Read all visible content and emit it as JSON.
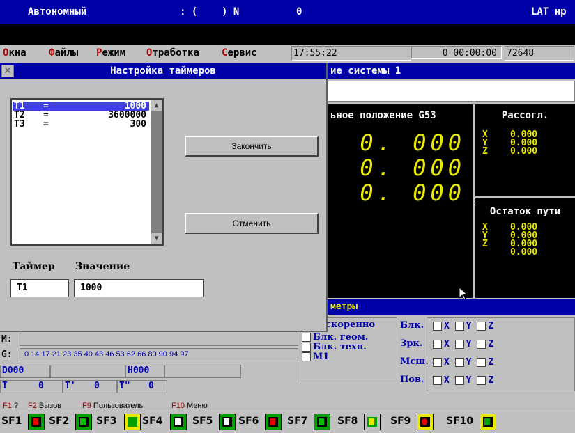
{
  "topbar": {
    "mode": "Автономный",
    "status1": ": (",
    "status2": ") N",
    "status3": "0",
    "right": "LAT нр"
  },
  "menu": {
    "items": [
      {
        "hotkey": "О",
        "rest": "кна"
      },
      {
        "hotkey": "Ф",
        "rest": "айлы"
      },
      {
        "hotkey": "Р",
        "rest": "ежим"
      },
      {
        "hotkey": "О",
        "rest": "тработка"
      },
      {
        "hotkey": "С",
        "rest": "ервис"
      }
    ],
    "time": "17:55:22",
    "elapsed": "0 00:00:00",
    "counter": "72648"
  },
  "bg_window": {
    "title": "ие системы 1",
    "position_title": "ьное положение G53",
    "position_values": [
      "0. 000",
      "0. 000",
      "0. 000"
    ],
    "sogl_title": "Рассогл.",
    "sogl_axes": [
      "X",
      "Y",
      "Z"
    ],
    "sogl_values": [
      "0.000",
      "0.000",
      "0.000"
    ],
    "ost_title": "Остаток пути",
    "ost_axes": [
      "X",
      "Y",
      "Z"
    ],
    "ost_values": [
      "0.000",
      "0.000",
      "0.000",
      "0.000"
    ],
    "params_label": "метры",
    "speed_label": "скоренно",
    "checks": [
      "Блк. геом.",
      "Блк. техн.",
      "M1"
    ],
    "axis_rows": [
      {
        "label": "Блк.",
        "axes": [
          "X",
          "Y",
          "Z"
        ]
      },
      {
        "label": "Зрк.",
        "axes": [
          "X",
          "Y",
          "Z"
        ]
      },
      {
        "label": "Мсш.",
        "axes": [
          "X",
          "Y",
          "Z"
        ]
      },
      {
        "label": "Пов.",
        "axes": [
          "X",
          "Y",
          "Z"
        ]
      }
    ]
  },
  "dialog": {
    "title": "Настройка таймеров",
    "timers": [
      {
        "name": "T1",
        "eq": "=",
        "value": "1000"
      },
      {
        "name": "T2",
        "eq": "=",
        "value": "3600000"
      },
      {
        "name": "T3",
        "eq": "=",
        "value": "300"
      }
    ],
    "finish_button": "Закончить",
    "cancel_button": "Отменить",
    "timer_label": "Таймер",
    "value_label": "Значение",
    "timer_field": "T1",
    "value_field": "1000"
  },
  "info": {
    "m_label": "M:",
    "g_label": "G:",
    "g_codes": "0 14 17 21 23 35 40 43 46 53 62 66 80 90 94 97",
    "d_code": "D000",
    "h_code": "H000",
    "t_label": "T",
    "t_val": "0",
    "t1_label": "T'",
    "t1_val": "0",
    "t2_label": "T\"",
    "t2_val": "0"
  },
  "hints": [
    {
      "key": "F1",
      "text": "?"
    },
    {
      "key": "F2",
      "text": "Вызов"
    },
    {
      "key": "F9",
      "text": "Пользователь"
    },
    {
      "key": "F10",
      "text": "Меню"
    }
  ],
  "fkeys": [
    "SF1",
    "SF2",
    "SF3",
    "SF4",
    "SF5",
    "SF6",
    "SF7",
    "SF8",
    "SF9",
    "SF10"
  ],
  "colors": {
    "titlebar": "#0000a8",
    "accent_red": "#a80000",
    "display_yellow": "#e8e800",
    "icon_green": "#00a000"
  }
}
